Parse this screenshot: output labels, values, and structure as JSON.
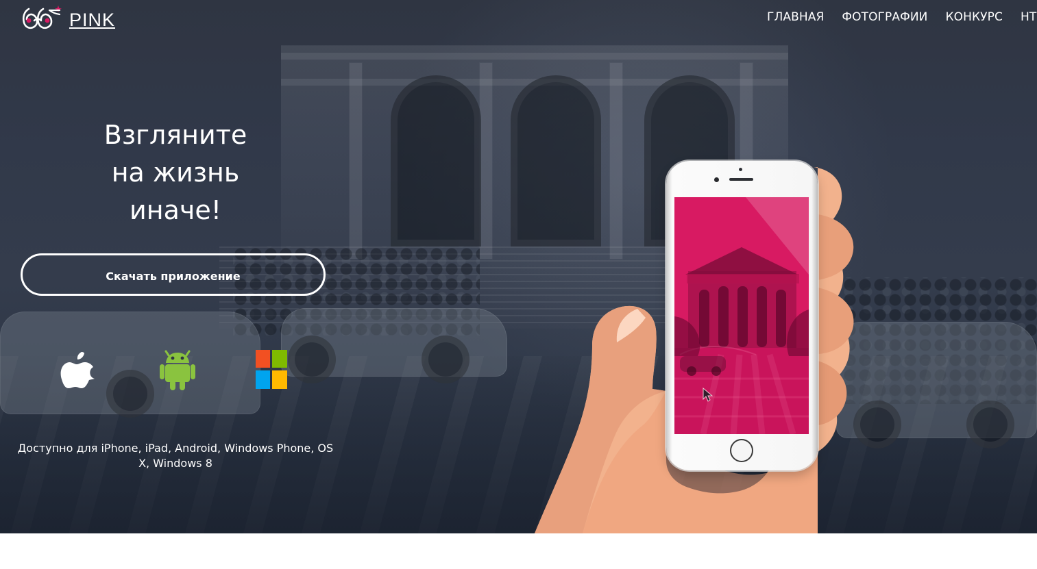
{
  "header": {
    "brand": {
      "name": "PINK",
      "logo_icon": "pink-glasses-logo-icon"
    },
    "nav": [
      {
        "label": "ГЛАВНАЯ"
      },
      {
        "label": "ФОТОГРАФИИ"
      },
      {
        "label": "КОНКУРС"
      },
      {
        "label": "HTI"
      }
    ]
  },
  "hero": {
    "title_lines": [
      "Взгляните",
      "на жизнь",
      "иначе!"
    ],
    "cta_label": "Скачать приложение",
    "availability": "Доступно для iPhone, iPad, Android, Windows Phone, OS X, Windows 8",
    "platform_icons": [
      {
        "name": "apple-icon"
      },
      {
        "name": "android-icon"
      },
      {
        "name": "windows-icon"
      }
    ],
    "phone_screen_color": "#d81a62",
    "background_color": "#2f3542"
  },
  "colors": {
    "accent": "#d81a62",
    "text": "#ffffff",
    "android": "#8ac33f",
    "windows_red": "#f25022",
    "windows_green": "#7fba00",
    "windows_blue": "#00a4ef",
    "windows_yellow": "#ffb900"
  }
}
